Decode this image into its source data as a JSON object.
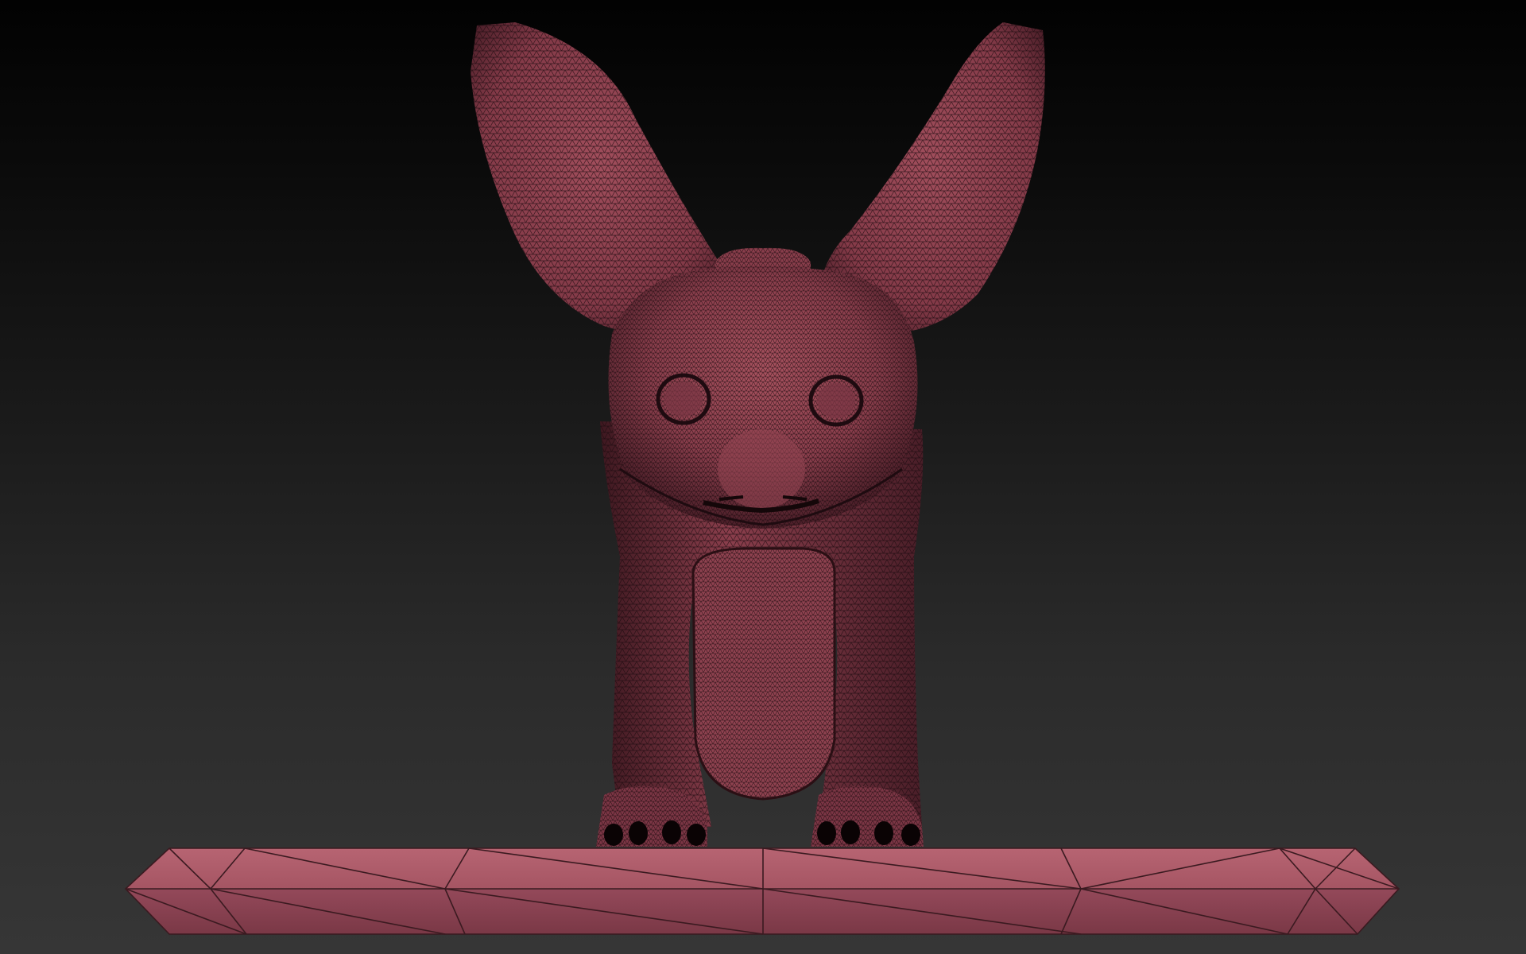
{
  "viewport": {
    "background_top": "#020202",
    "background_bottom": "#363636"
  },
  "model": {
    "material_color": "#9a4a58",
    "material_shadow": "#4a1e28",
    "wire_color": "#1a0a0e",
    "type": "wireframe-creature"
  },
  "base": {
    "material_color": "#b86472",
    "edge_color": "#3a1a20",
    "type": "low-poly-base"
  }
}
